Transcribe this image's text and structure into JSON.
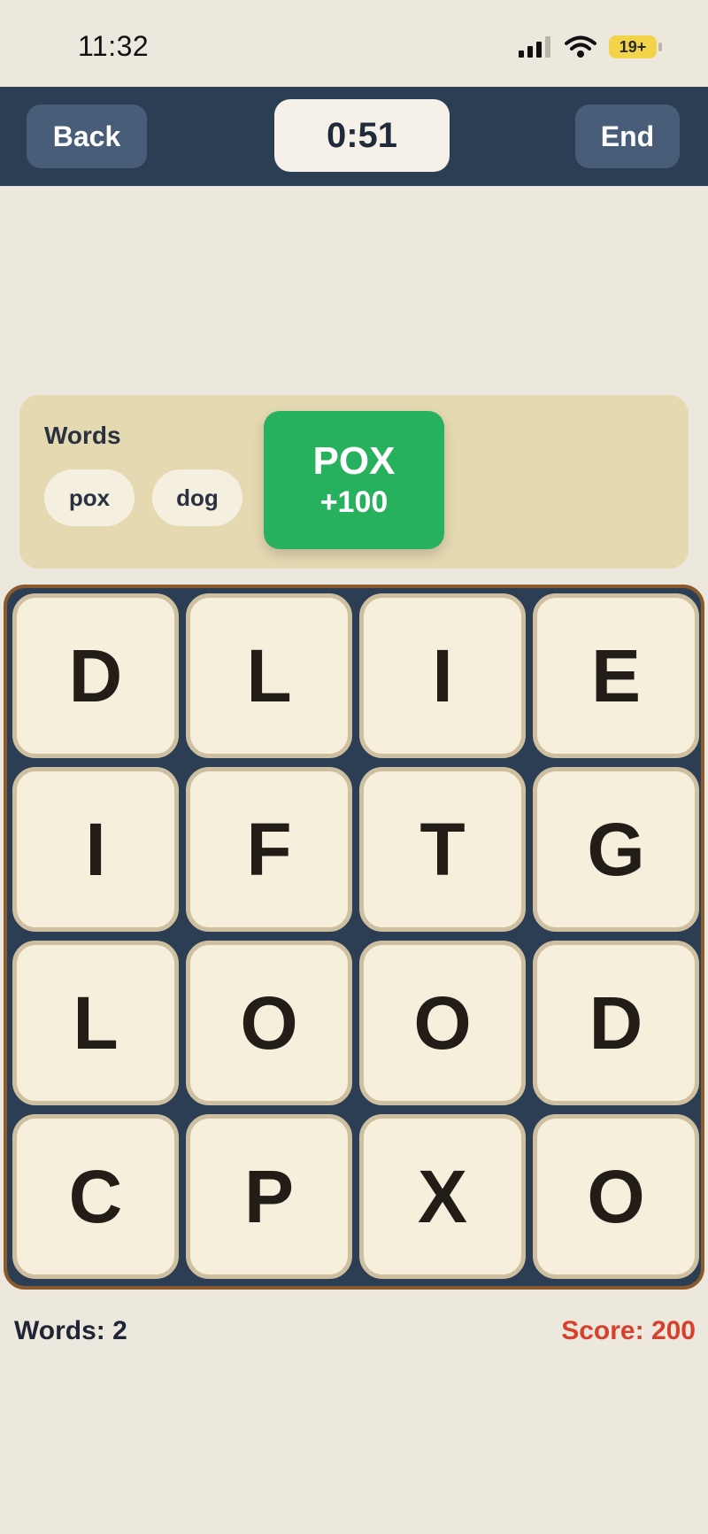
{
  "status": {
    "time": "11:32",
    "battery": "19+"
  },
  "header": {
    "back_label": "Back",
    "timer": "0:51",
    "end_label": "End"
  },
  "words_panel": {
    "title": "Words",
    "found": [
      "pox",
      "dog"
    ],
    "flash": {
      "word": "POX",
      "points": "+100"
    }
  },
  "board": {
    "tiles": [
      "D",
      "L",
      "I",
      "E",
      "I",
      "F",
      "T",
      "G",
      "L",
      "O",
      "O",
      "D",
      "C",
      "P",
      "X",
      "O"
    ]
  },
  "footer": {
    "words_count": "Words: 2",
    "score": "Score: 200"
  },
  "colors": {
    "accent_green": "#27b05d",
    "header_navy": "#2c3e53",
    "score_red": "#d6402c"
  }
}
